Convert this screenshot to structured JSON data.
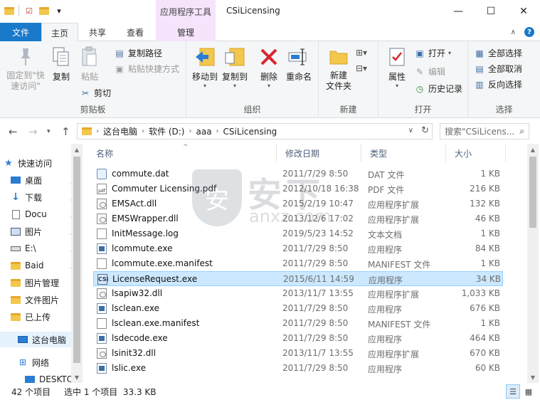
{
  "window": {
    "title": "CSiLicensing",
    "context_tab": "应用程序工具",
    "minimize": "—",
    "maximize": "☐",
    "close": "✕"
  },
  "tabs": {
    "file": "文件",
    "home": "主页",
    "share": "共享",
    "view": "查看",
    "manage": "管理"
  },
  "ribbon": {
    "clipboard": {
      "label": "剪贴板",
      "pin": "固定到\"快\n速访问\"",
      "copy": "复制",
      "paste": "粘贴",
      "copy_path": "复制路径",
      "paste_shortcut": "粘贴快捷方式",
      "cut": "剪切"
    },
    "organize": {
      "label": "组织",
      "move_to": "移动到",
      "copy_to": "复制到",
      "delete": "删除",
      "rename": "重命名"
    },
    "new": {
      "label": "新建",
      "new_folder": "新建\n文件夹"
    },
    "open": {
      "label": "打开",
      "properties": "属性",
      "open": "打开",
      "edit": "编辑",
      "history": "历史记录"
    },
    "select": {
      "label": "选择",
      "select_all": "全部选择",
      "select_none": "全部取消",
      "invert": "反向选择"
    }
  },
  "address": {
    "crumbs": [
      "这台电脑",
      "软件 (D:)",
      "aaa",
      "CSiLicensing"
    ],
    "search_placeholder": "搜索\"CSiLicens..."
  },
  "nav": {
    "quick_access": "快速访问",
    "items": [
      "桌面",
      "下载",
      "Docu",
      "图片",
      "E:\\",
      "Baid",
      "图片管理",
      "文件图片",
      "已上传"
    ],
    "this_pc": "这台电脑",
    "network": "网络",
    "desktop_pc": "DESKTO"
  },
  "columns": {
    "name": "名称",
    "date": "修改日期",
    "type": "类型",
    "size": "大小"
  },
  "files": [
    {
      "name": "commute.dat",
      "date": "2011/7/29 8:50",
      "type": "DAT 文件",
      "size": "1 KB",
      "icon": "dat"
    },
    {
      "name": "Commuter Licensing.pdf",
      "date": "2012/10/18 16:38",
      "type": "PDF 文件",
      "size": "216 KB",
      "icon": "pdf"
    },
    {
      "name": "EMSAct.dll",
      "date": "2015/2/19 10:47",
      "type": "应用程序扩展",
      "size": "132 KB",
      "icon": "dll"
    },
    {
      "name": "EMSWrapper.dll",
      "date": "2013/12/6 17:02",
      "type": "应用程序扩展",
      "size": "46 KB",
      "icon": "dll"
    },
    {
      "name": "InitMessage.log",
      "date": "2019/5/23 14:52",
      "type": "文本文档",
      "size": "1 KB",
      "icon": "doc"
    },
    {
      "name": "lcommute.exe",
      "date": "2011/7/29 8:50",
      "type": "应用程序",
      "size": "84 KB",
      "icon": "exe"
    },
    {
      "name": "lcommute.exe.manifest",
      "date": "2011/7/29 8:50",
      "type": "MANIFEST 文件",
      "size": "1 KB",
      "icon": "doc"
    },
    {
      "name": "LicenseRequest.exe",
      "date": "2015/6/11 14:59",
      "type": "应用程序",
      "size": "34 KB",
      "icon": "csi"
    },
    {
      "name": "lsapiw32.dll",
      "date": "2013/11/7 13:55",
      "type": "应用程序扩展",
      "size": "1,033 KB",
      "icon": "dll"
    },
    {
      "name": "lsclean.exe",
      "date": "2011/7/29 8:50",
      "type": "应用程序",
      "size": "676 KB",
      "icon": "exe"
    },
    {
      "name": "lsclean.exe.manifest",
      "date": "2011/7/29 8:50",
      "type": "MANIFEST 文件",
      "size": "1 KB",
      "icon": "doc"
    },
    {
      "name": "lsdecode.exe",
      "date": "2011/7/29 8:50",
      "type": "应用程序",
      "size": "464 KB",
      "icon": "exe"
    },
    {
      "name": "lsinit32.dll",
      "date": "2013/11/7 13:55",
      "type": "应用程序扩展",
      "size": "670 KB",
      "icon": "dll"
    },
    {
      "name": "lslic.exe",
      "date": "2011/7/29 8:50",
      "type": "应用程序",
      "size": "60 KB",
      "icon": "exe"
    }
  ],
  "selected_index": 7,
  "watermark": {
    "line1": "安下",
    "line2": "anxz.com"
  },
  "status": {
    "count": "42 个项目",
    "selected": "选中 1 个项目  33.3 KB"
  }
}
